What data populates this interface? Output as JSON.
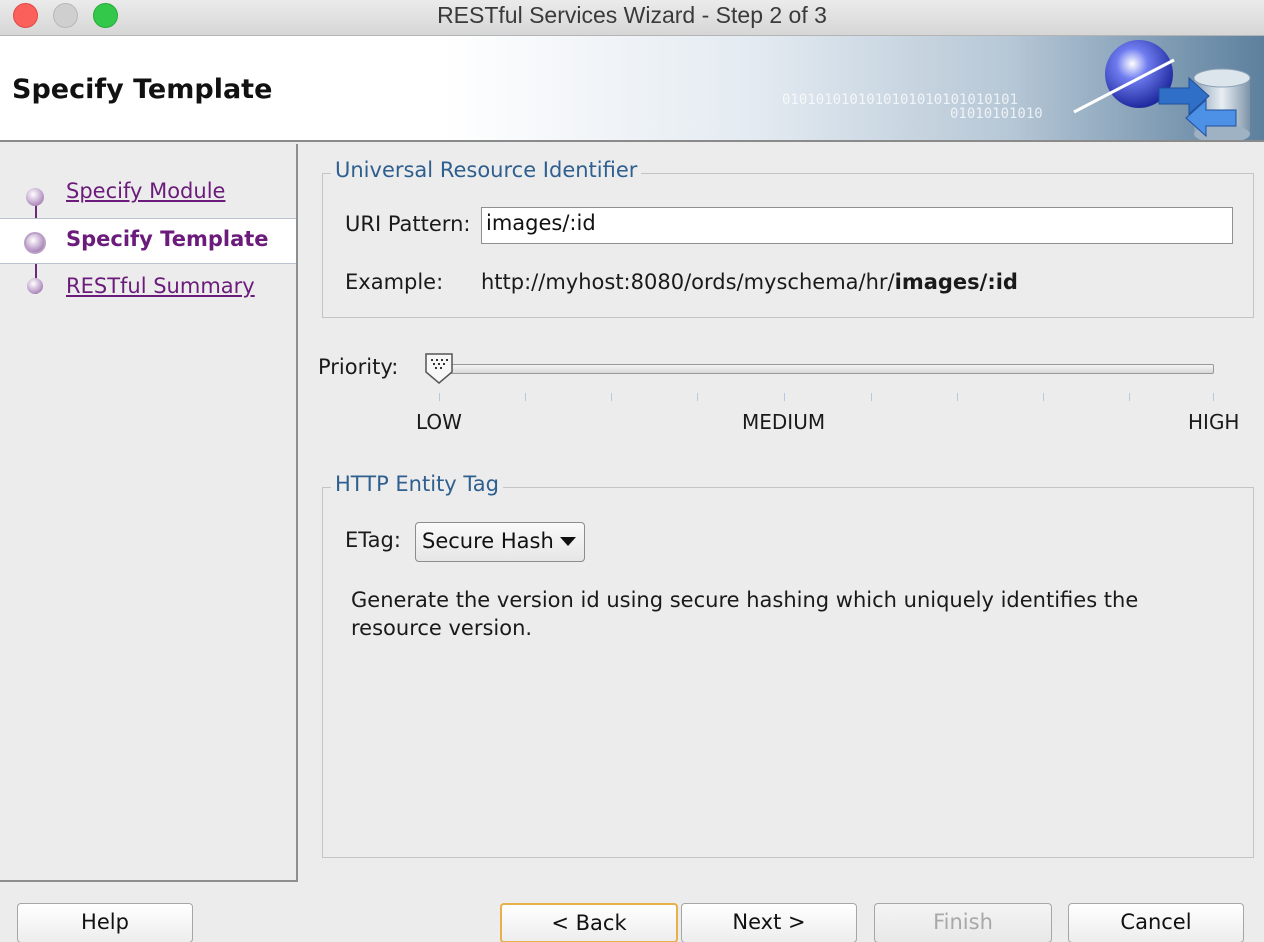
{
  "window": {
    "title": "RESTful Services Wizard - Step 2 of 3"
  },
  "banner": {
    "title": "Specify Template",
    "binary_1": "0101010101010101010101010101",
    "binary_2": "01010101010"
  },
  "nav": {
    "items": [
      {
        "label": "Specify Module",
        "state": "link"
      },
      {
        "label": "Specify Template",
        "state": "current"
      },
      {
        "label": "RESTful Summary",
        "state": "link"
      }
    ]
  },
  "uri": {
    "group_title": "Universal Resource Identifier",
    "pattern_label": "URI Pattern:",
    "pattern_value": "images/:id",
    "example_label": "Example:",
    "example_prefix": "http://myhost:8080/ords/myschema/hr/",
    "example_bold": "images/:id"
  },
  "priority": {
    "label": "Priority:",
    "value": 0,
    "min_label": "LOW",
    "mid_label": "MEDIUM",
    "max_label": "HIGH"
  },
  "etag": {
    "group_title": "HTTP Entity Tag",
    "label": "ETag:",
    "selected": "Secure Hash",
    "description": "Generate the version id using secure hashing which uniquely identifies the resource version."
  },
  "buttons": {
    "help": "Help",
    "back": "< Back",
    "next": "Next >",
    "finish": "Finish",
    "cancel": "Cancel"
  },
  "colors": {
    "nav_accent": "#6b1b7b",
    "group_title": "#2e5f8f",
    "default_button_border": "#e8b04a"
  }
}
